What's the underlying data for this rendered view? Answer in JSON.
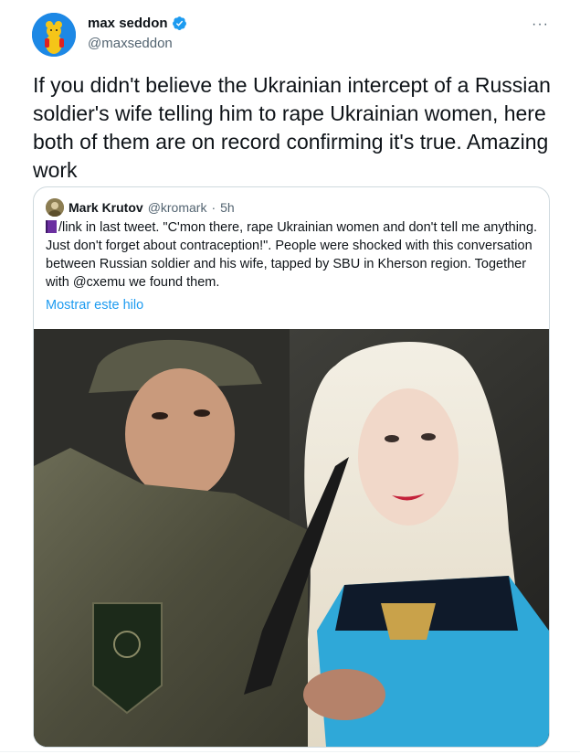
{
  "author": {
    "display_name": "max seddon",
    "handle": "@maxseddon",
    "verified": true,
    "avatar_icon": "bear-avatar-icon"
  },
  "more_icon": "···",
  "tweet_text": "If you didn't believe the Ukrainian intercept of a Russian soldier's wife telling him to rape Ukrainian women, here both of them are on record confirming it's true. Amazing work",
  "quote": {
    "display_name": "Mark Krutov",
    "handle": "@kromark",
    "separator": "·",
    "time": "5h",
    "text": "/link in last tweet. \"C'mon there, rape Ukrainian women and don't tell me anything. Just don't forget about contraception!\". People were shocked with this conversation between Russian soldier and his wife, tapped by SBU in Kherson region. Together with @cxemu we found them.",
    "show_thread": "Mostrar este hilo"
  },
  "colors": {
    "link": "#1d9bf0",
    "verified": "#1d9bf0",
    "secondary_text": "#536471"
  }
}
